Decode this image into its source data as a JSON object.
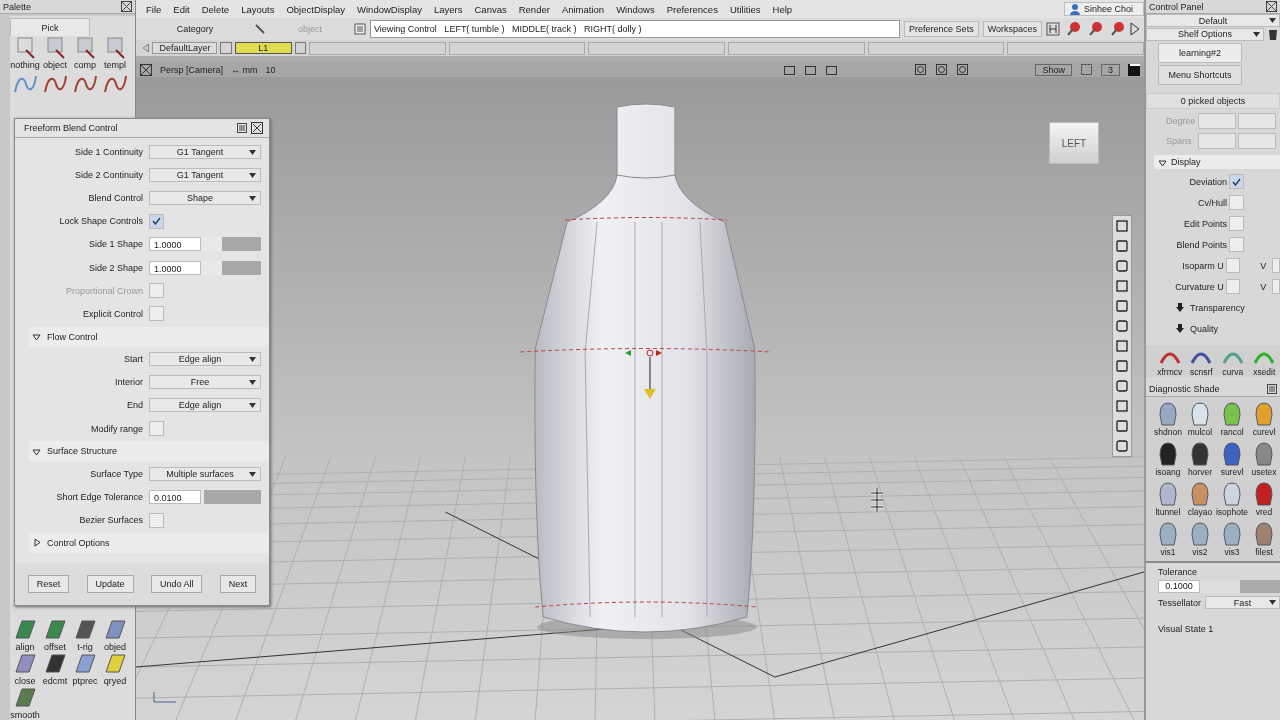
{
  "palette": {
    "title": "Palette",
    "tab": "Pick",
    "top_tools": [
      "nothing",
      "object",
      "comp",
      "templ"
    ],
    "bottom_tools": [
      "align",
      "offset",
      "t-rig",
      "objed",
      "close",
      "edcmt",
      "ptprec",
      "qryed",
      "smooth"
    ]
  },
  "menu": [
    "File",
    "Edit",
    "Delete",
    "Layouts",
    "ObjectDisplay",
    "WindowDisplay",
    "Layers",
    "Canvas",
    "Render",
    "Animation",
    "Windows",
    "Preferences",
    "Utilities",
    "Help"
  ],
  "user": "Sinhee Choi",
  "toolbar": {
    "category": "Category",
    "object": "object",
    "prompt": "Viewing Control   LEFT( tumble )   MIDDLE( track )   RIGHT( dolly )",
    "buttons": [
      "Preference Sets",
      "Workspaces"
    ]
  },
  "layers": [
    {
      "name": "DefaultLayer",
      "selected": false
    },
    {
      "name": "L1",
      "selected": true
    }
  ],
  "viewport": {
    "camera": "Persp [Camera]",
    "units": "↔ mm",
    "grid": "10",
    "show": "Show",
    "count": "3",
    "view_cube": "LEFT"
  },
  "dialog": {
    "title": "Freeform Blend Control",
    "rows": [
      {
        "kind": "dropdown",
        "label": "Side 1 Continuity",
        "value": "G1 Tangent"
      },
      {
        "kind": "dropdown",
        "label": "Side 2 Continuity",
        "value": "G1 Tangent"
      },
      {
        "kind": "dropdown",
        "label": "Blend Control",
        "value": "Shape"
      },
      {
        "kind": "checkbox",
        "label": "Lock Shape Controls",
        "checked": true,
        "disabled": false
      },
      {
        "kind": "number",
        "label": "Side 1 Shape",
        "value": "1.0000",
        "level": 0.35
      },
      {
        "kind": "number",
        "label": "Side 2 Shape",
        "value": "1.0000",
        "level": 0.35
      },
      {
        "kind": "checkbox",
        "label": "Proportional Crown",
        "checked": false,
        "disabled": true
      },
      {
        "kind": "checkbox",
        "label": "Explicit Control",
        "checked": false,
        "disabled": false
      },
      {
        "kind": "section",
        "label": "Flow Control",
        "expanded": true
      },
      {
        "kind": "dropdown",
        "label": "Start",
        "value": "Edge align"
      },
      {
        "kind": "dropdown",
        "label": "Interior",
        "value": "Free"
      },
      {
        "kind": "dropdown",
        "label": "End",
        "value": "Edge align"
      },
      {
        "kind": "checkbox",
        "label": "Modify range",
        "checked": false,
        "disabled": false
      },
      {
        "kind": "section",
        "label": "Surface Structure",
        "expanded": true
      },
      {
        "kind": "dropdown",
        "label": "Surface Type",
        "value": "Multiple surfaces"
      },
      {
        "kind": "number",
        "label": "Short Edge Tolerance",
        "value": "0.0100",
        "level": 0.05
      },
      {
        "kind": "checkbox",
        "label": "Bezier Surfaces",
        "checked": false,
        "disabled": false
      },
      {
        "kind": "section",
        "label": "Control Options",
        "expanded": false
      }
    ],
    "buttons": [
      "Reset",
      "Update",
      "Undo All",
      "Next"
    ]
  },
  "control_panel": {
    "title": "Control Panel",
    "preset": "Default",
    "shelf_options": "Shelf Options",
    "tabs": [
      {
        "label": "learning#2",
        "selected": true
      },
      {
        "label": "Menu Shortcuts",
        "selected": false
      }
    ],
    "picked": "0 picked objects",
    "fields": [
      "Degree",
      "Spans"
    ],
    "display": {
      "label": "Display",
      "expanded": true,
      "rows": [
        {
          "label": "Deviation",
          "checked": true
        },
        {
          "label": "Cv/Hull",
          "checked": false
        },
        {
          "label": "Edit Points",
          "checked": false
        },
        {
          "label": "Blend Points",
          "checked": false
        },
        {
          "label": "Isoparm U",
          "checked": false,
          "v_label": "V",
          "v_checked": false
        },
        {
          "label": "Curvature U",
          "checked": false,
          "v_label": "V",
          "v_checked": false
        }
      ],
      "subsections": [
        {
          "label": "Transparency",
          "expanded": false
        },
        {
          "label": "Quality",
          "expanded": false
        }
      ]
    },
    "shelf": [
      "xfrmcv",
      "scnsrf",
      "curva",
      "xsedit"
    ]
  },
  "diagnostic_shade": {
    "title": "Diagnostic Shade",
    "tools": [
      "shdnon",
      "mulcol",
      "rancol",
      "curevl",
      "isoang",
      "horver",
      "surevl",
      "usetex",
      "ltunnel",
      "clayao",
      "isophote",
      "vred",
      "vis1",
      "vis2",
      "vis3",
      "filest"
    ],
    "tolerance_label": "Tolerance",
    "tolerance": "0.1000",
    "tolerance_slider": {
      "level": 0.5
    },
    "tessellator_label": "Tessellator",
    "tessellator": "Fast",
    "visual_state": "Visual State 1"
  }
}
